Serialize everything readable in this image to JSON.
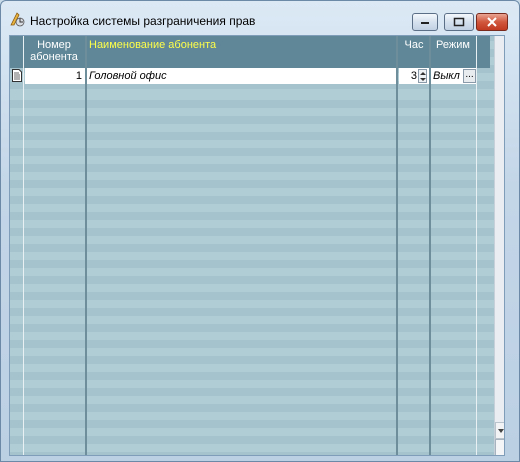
{
  "window": {
    "title": "Настройка системы разграничения прав"
  },
  "grid": {
    "columns": [
      {
        "label": "Номер абонента",
        "line1": "Номер",
        "line2": "абонента"
      },
      {
        "label": "Наименование абонента"
      },
      {
        "label": "Час"
      },
      {
        "label": "Режим"
      }
    ],
    "rows": [
      {
        "number": "1",
        "name": "Головной офис",
        "hour": "3",
        "mode": "Выкл"
      }
    ],
    "ellipsis": "..."
  },
  "colors": {
    "header_bg": "#5f8797",
    "active_header_text": "#ffff4a",
    "stripe_light": "#b0ccd4",
    "stripe_dark": "#a4c3cc"
  },
  "icons": [
    "app-icon",
    "minimize-icon",
    "maximize-icon",
    "close-icon",
    "record-icon",
    "spin-up-icon",
    "spin-down-icon",
    "scroll-down-icon"
  ]
}
